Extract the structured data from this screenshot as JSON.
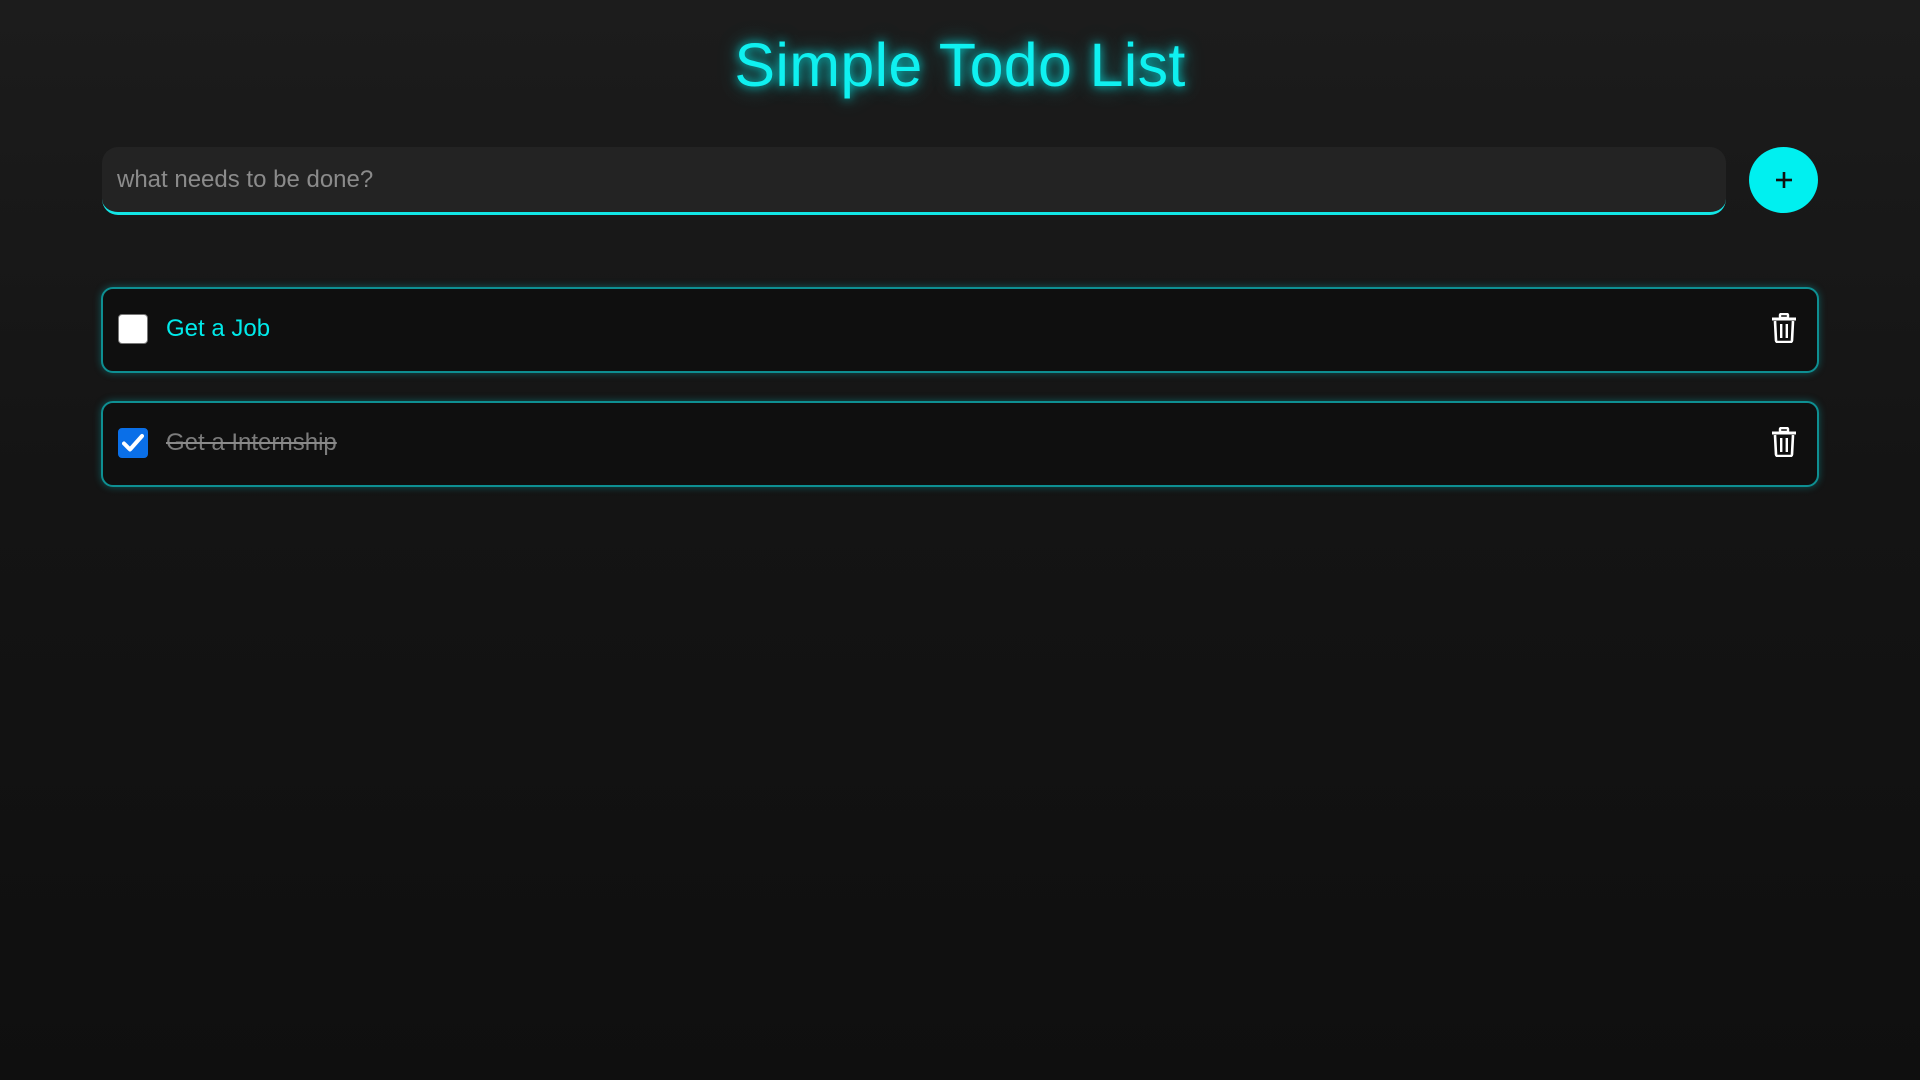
{
  "title": "Simple Todo List",
  "input": {
    "placeholder": "what needs to be done?",
    "value": ""
  },
  "add_button": {
    "icon": "plus-icon"
  },
  "todos": [
    {
      "text": "Get a Job",
      "completed": false,
      "delete_icon": "trash-icon"
    },
    {
      "text": "Get a Internship",
      "completed": true,
      "delete_icon": "trash-icon"
    }
  ],
  "colors": {
    "accent": "#00f0f0",
    "checkbox_checked": "#0a6fe8",
    "background": "#141414"
  }
}
